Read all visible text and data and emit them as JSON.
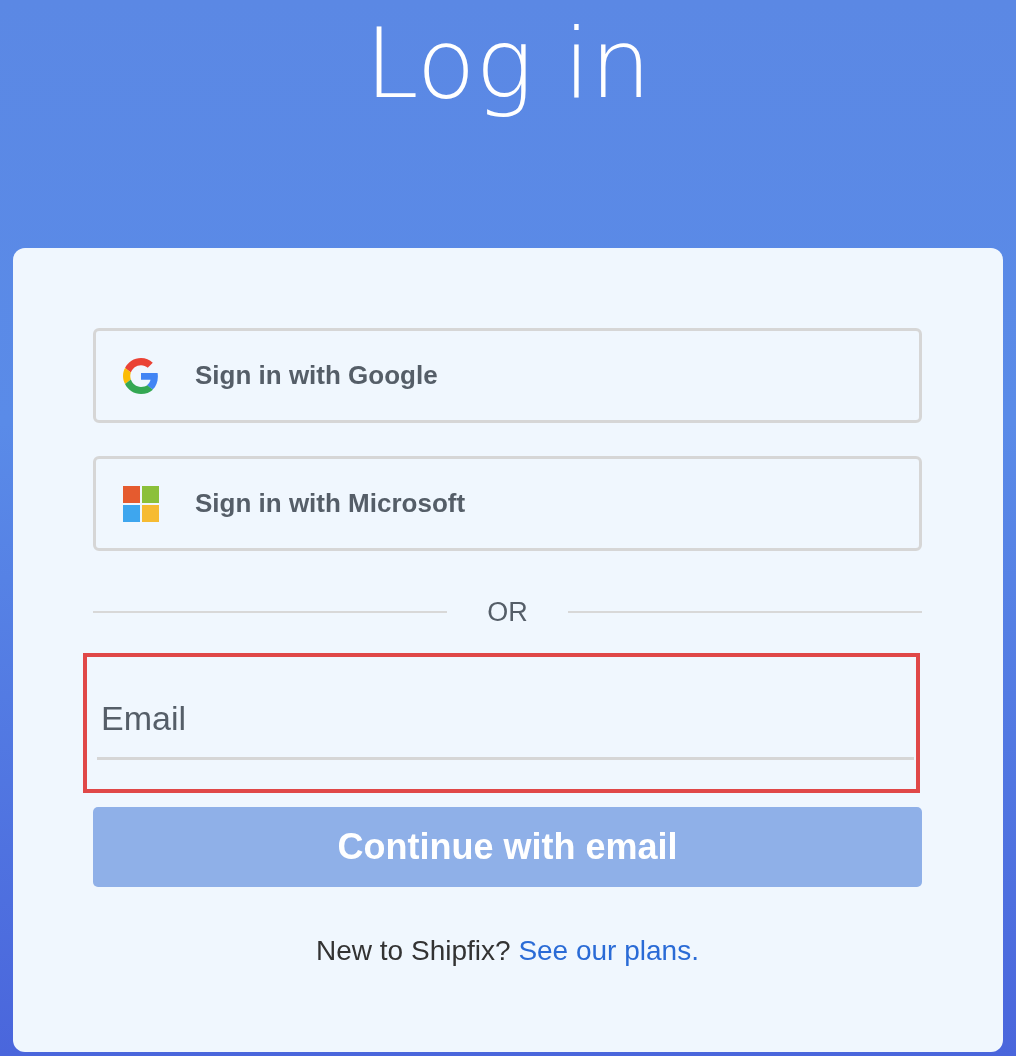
{
  "title": "Log in",
  "sso_buttons": [
    {
      "kind": "google",
      "label": "Sign in with Google"
    },
    {
      "kind": "microsoft",
      "label": "Sign in with Microsoft"
    }
  ],
  "divider": "OR",
  "email": {
    "placeholder": "Email",
    "highlighted": true
  },
  "continue_button": {
    "label": "Continue with email",
    "disabled": true
  },
  "footer": {
    "text": "New to Shipfix?",
    "link": "See our plans."
  }
}
